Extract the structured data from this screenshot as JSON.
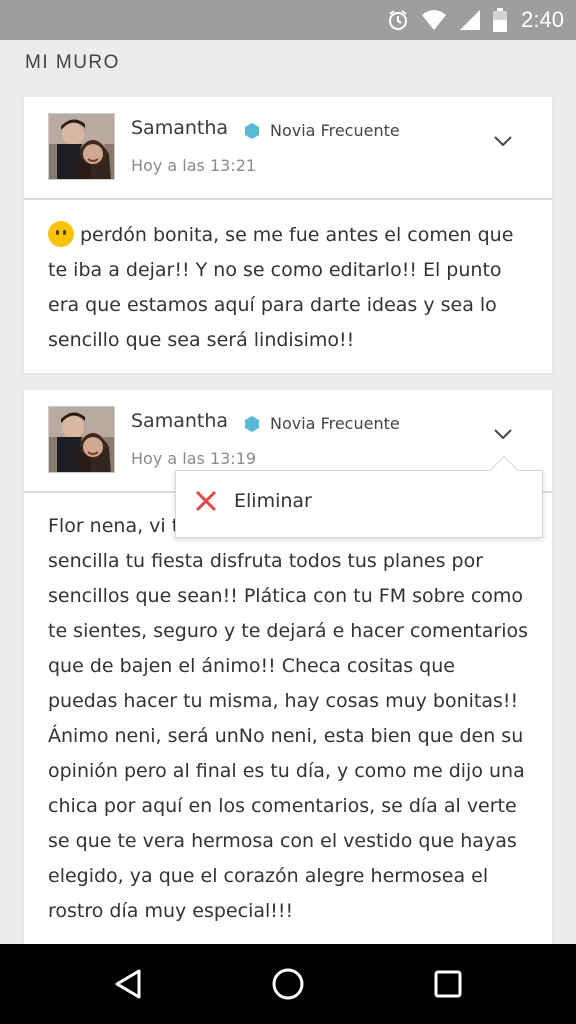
{
  "status_bar": {
    "time": "2:40",
    "icons": [
      "alarm-icon",
      "wifi-icon",
      "signal-icon",
      "battery-icon"
    ]
  },
  "page": {
    "title": "MI MURO"
  },
  "posts": [
    {
      "author": "Samantha",
      "badge": "Novia Frecuente",
      "time": "Hoy a las 13:21",
      "body": "perdón bonita, se me fue antes el comen que te iba a dejar!! Y no se como editarlo!! El punto era que estamos aquí para darte ideas y sea lo sencillo que sea será lindisimo!!",
      "has_emoji": true
    },
    {
      "author": "Samantha",
      "badge": "Novia Frecuente",
      "time": "Hoy a las 13:19",
      "body": "Flor nena, vi tus mensajes y no importa que sea sencilla tu fiesta disfruta todos tus planes por sencillos que sean!! Plática con tu FM sobre como te sientes, seguro y te dejará e hacer comentarios que de bajen el ánimo!! Checa cositas que puedas hacer tu misma, hay cosas muy bonitas!! Ánimo neni, será unNo neni, esta bien que den su opinión pero al final es tu día, y como me dijo una chica por aquí en los comentarios, se día al verte se que te vera hermosa con el vestido que hayas elegido, ya que el corazón alegre hermosea el rostro día muy especial!!!"
    }
  ],
  "popup": {
    "delete_label": "Eliminar"
  },
  "colors": {
    "badge": "#5bb8d6",
    "delete": "#e04848",
    "status_bar": "#9e9e9e"
  }
}
